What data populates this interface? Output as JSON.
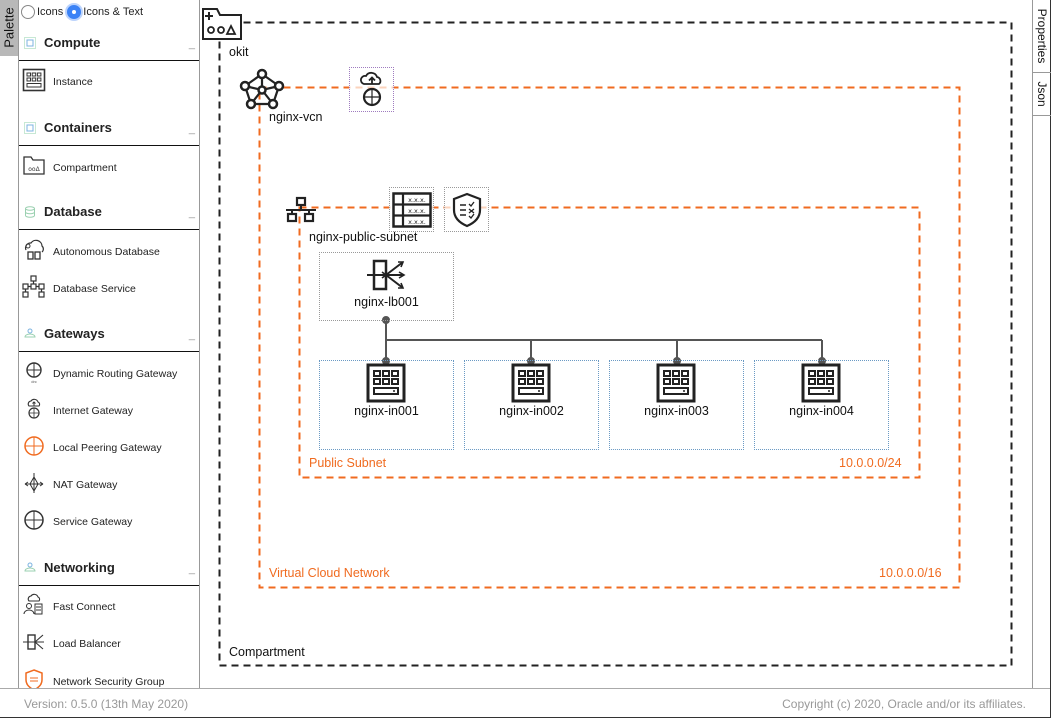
{
  "palette_tab": "Palette",
  "view_mode": {
    "options": [
      {
        "label": "Icons",
        "selected": false
      },
      {
        "label": "Icons & Text",
        "selected": true
      }
    ]
  },
  "sidebar": {
    "sections": [
      {
        "title": "Compute",
        "items": [
          {
            "label": "Instance",
            "icon": "instance-icon"
          }
        ]
      },
      {
        "title": "Containers",
        "items": [
          {
            "label": "Compartment",
            "icon": "compartment-icon"
          }
        ]
      },
      {
        "title": "Database",
        "items": [
          {
            "label": "Autonomous Database",
            "icon": "autonomous-database-icon"
          },
          {
            "label": "Database Service",
            "icon": "database-service-icon"
          }
        ]
      },
      {
        "title": "Gateways",
        "items": [
          {
            "label": "Dynamic Routing Gateway",
            "icon": "dynamic-routing-gateway-icon"
          },
          {
            "label": "Internet Gateway",
            "icon": "internet-gateway-icon"
          },
          {
            "label": "Local Peering Gateway",
            "icon": "local-peering-gateway-icon"
          },
          {
            "label": "NAT Gateway",
            "icon": "nat-gateway-icon"
          },
          {
            "label": "Service Gateway",
            "icon": "service-gateway-icon"
          }
        ]
      },
      {
        "title": "Networking",
        "items": [
          {
            "label": "Fast Connect",
            "icon": "fast-connect-icon"
          },
          {
            "label": "Load Balancer",
            "icon": "load-balancer-icon"
          },
          {
            "label": "Network Security Group",
            "icon": "network-security-group-icon"
          }
        ]
      }
    ],
    "minimize_glyph": "_"
  },
  "right_tabs": [
    "Properties",
    "Json"
  ],
  "canvas": {
    "compartment": {
      "name": "okit",
      "type_label": "Compartment"
    },
    "vcn": {
      "name": "nginx-vcn",
      "type_label": "Virtual Cloud Network",
      "cidr": "10.0.0.0/16"
    },
    "subnet": {
      "name": "nginx-public-subnet",
      "type_label": "Public Subnet",
      "cidr": "10.0.0.0/24"
    },
    "load_balancer": {
      "name": "nginx-lb001"
    },
    "instances": [
      {
        "name": "nginx-in001"
      },
      {
        "name": "nginx-in002"
      },
      {
        "name": "nginx-in003"
      },
      {
        "name": "nginx-in004"
      }
    ],
    "route_table_glyph": "x.x.x.",
    "colors": {
      "vcn_border": "#f06b20",
      "compartment_border": "#222222",
      "connector": "#555555"
    }
  },
  "footer": {
    "version": "Version: 0.5.0 (13th May 2020)",
    "copyright": "Copyright (c) 2020, Oracle and/or its affiliates."
  }
}
